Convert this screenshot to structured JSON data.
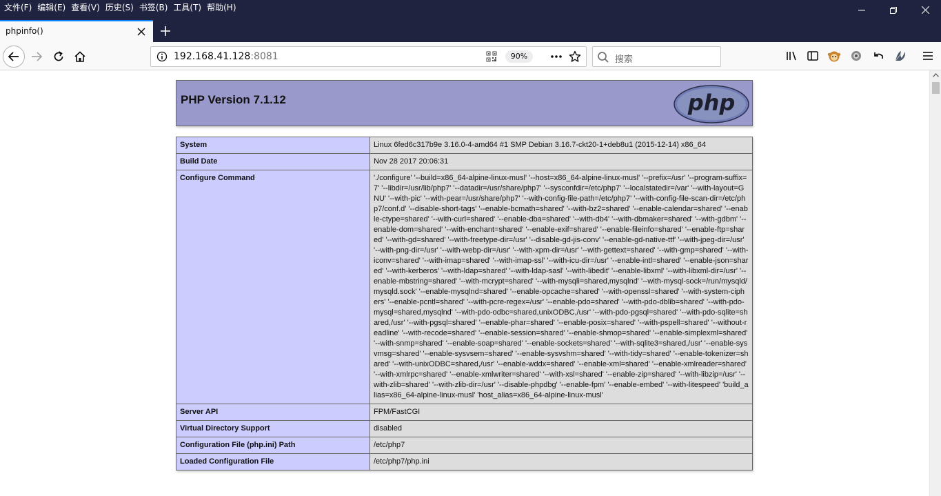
{
  "menubar": {
    "items": [
      "文件(F)",
      "编辑(E)",
      "查看(V)",
      "历史(S)",
      "书签(B)",
      "工具(T)",
      "帮助(H)"
    ]
  },
  "tab": {
    "title": "phpinfo()"
  },
  "urlbar": {
    "host": "192.168.41.128",
    "port": ":8081",
    "zoom": "90%"
  },
  "searchbar": {
    "placeholder": "搜索"
  },
  "page": {
    "title": "PHP Version 7.1.12",
    "logo_text": "php",
    "rows": [
      {
        "key": "System",
        "value": "Linux 6fed6c317b9e 3.16.0-4-amd64 #1 SMP Debian 3.16.7-ckt20-1+deb8u1 (2015-12-14) x86_64"
      },
      {
        "key": "Build Date",
        "value": "Nov 28 2017 20:06:31"
      },
      {
        "key": "Configure Command",
        "value": "'./configure' '--build=x86_64-alpine-linux-musl' '--host=x86_64-alpine-linux-musl' '--prefix=/usr' '--program-suffix=7' '--libdir=/usr/lib/php7' '--datadir=/usr/share/php7' '--sysconfdir=/etc/php7' '--localstatedir=/var' '--with-layout=GNU' '--with-pic' '--with-pear=/usr/share/php7' '--with-config-file-path=/etc/php7' '--with-config-file-scan-dir=/etc/php7/conf.d' '--disable-short-tags' '--enable-bcmath=shared' '--with-bz2=shared' '--enable-calendar=shared' '--enable-ctype=shared' '--with-curl=shared' '--enable-dba=shared' '--with-db4' '--with-dbmaker=shared' '--with-gdbm' '--enable-dom=shared' '--with-enchant=shared' '--enable-exif=shared' '--enable-fileinfo=shared' '--enable-ftp=shared' '--with-gd=shared' '--with-freetype-dir=/usr' '--disable-gd-jis-conv' '--enable-gd-native-ttf' '--with-jpeg-dir=/usr' '--with-png-dir=/usr' '--with-webp-dir=/usr' '--with-xpm-dir=/usr' '--with-gettext=shared' '--with-gmp=shared' '--with-iconv=shared' '--with-imap=shared' '--with-imap-ssl' '--with-icu-dir=/usr' '--enable-intl=shared' '--enable-json=shared' '--with-kerberos' '--with-ldap=shared' '--with-ldap-sasl' '--with-libedit' '--enable-libxml' '--with-libxml-dir=/usr' '--enable-mbstring=shared' '--with-mcrypt=shared' '--with-mysqli=shared,mysqlnd' '--with-mysql-sock=/run/mysqld/mysqld.sock' '--enable-mysqlnd=shared' '--enable-opcache=shared' '--with-openssl=shared' '--with-system-ciphers' '--enable-pcntl=shared' '--with-pcre-regex=/usr' '--enable-pdo=shared' '--with-pdo-dblib=shared' '--with-pdo-mysql=shared,mysqlnd' '--with-pdo-odbc=shared,unixODBC,/usr' '--with-pdo-pgsql=shared' '--with-pdo-sqlite=shared,/usr' '--with-pgsql=shared' '--enable-phar=shared' '--enable-posix=shared' '--with-pspell=shared' '--without-readline' '--with-recode=shared' '--enable-session=shared' '--enable-shmop=shared' '--enable-simplexml=shared' '--with-snmp=shared' '--enable-soap=shared' '--enable-sockets=shared' '--with-sqlite3=shared,/usr' '--enable-sysvmsg=shared' '--enable-sysvsem=shared' '--enable-sysvshm=shared' '--with-tidy=shared' '--enable-tokenizer=shared' '--with-unixODBC=shared,/usr' '--enable-wddx=shared' '--enable-xml=shared' '--enable-xmlreader=shared' '--with-xmlrpc=shared' '--enable-xmlwriter=shared' '--with-xsl=shared' '--enable-zip=shared' '--with-libzip=/usr' '--with-zlib=shared' '--with-zlib-dir=/usr' '--disable-phpdbg' '--enable-fpm' '--enable-embed' '--with-litespeed' 'build_alias=x86_64-alpine-linux-musl' 'host_alias=x86_64-alpine-linux-musl'"
      },
      {
        "key": "Server API",
        "value": "FPM/FastCGI"
      },
      {
        "key": "Virtual Directory Support",
        "value": "disabled"
      },
      {
        "key": "Configuration File (php.ini) Path",
        "value": "/etc/php7"
      },
      {
        "key": "Loaded Configuration File",
        "value": "/etc/php7/php.ini"
      }
    ]
  },
  "colors": {
    "titlebar": "#202340",
    "php_header": "#9999cc",
    "key_cell": "#ccccff",
    "value_cell": "#dddddd",
    "tab_accent": "#0a84ff"
  },
  "icons": {
    "back": "back-arrow-icon",
    "forward": "forward-arrow-icon",
    "reload": "reload-icon",
    "home": "home-icon",
    "info": "info-icon",
    "qr": "qr-code-icon",
    "more": "more-dots-icon",
    "bookmark": "star-icon",
    "search": "search-icon",
    "library": "library-icon",
    "sidebar": "sidebar-icon",
    "ext1": "extension-monkey-icon",
    "ext2": "extension-gear-icon",
    "undo": "undo-icon",
    "ext3": "extension-leaf-icon",
    "menu": "hamburger-menu-icon"
  }
}
